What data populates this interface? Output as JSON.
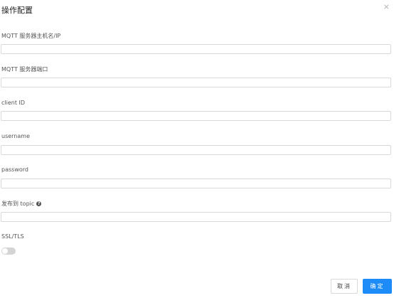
{
  "dialog": {
    "title": "操作配置",
    "close_glyph": "×"
  },
  "fields": {
    "host": {
      "label": "MQTT 服务器主机名/IP",
      "value": ""
    },
    "port": {
      "label": "MQTT 服务器端口",
      "value": ""
    },
    "client_id": {
      "label": "client ID",
      "value": ""
    },
    "username": {
      "label": "username",
      "value": ""
    },
    "password": {
      "label": "password",
      "value": ""
    },
    "topic": {
      "label": "发布到 topic",
      "value": "",
      "help_glyph": "?"
    }
  },
  "ssl": {
    "label": "SSL/TLS",
    "enabled": false
  },
  "footer": {
    "cancel_label": "取消",
    "ok_label": "确定"
  },
  "colors": {
    "primary": "#1d8cf8",
    "toggle_off": "#d4d4d4",
    "border": "#d9d9d9"
  }
}
